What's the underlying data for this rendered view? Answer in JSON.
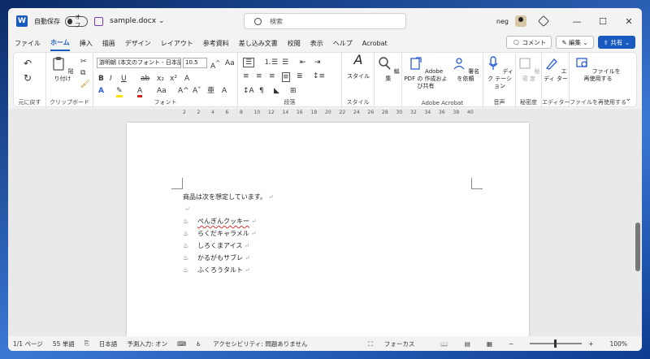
{
  "titlebar": {
    "autosave_label": "自動保存",
    "toggle_state": "オフ",
    "filename": "sample.docx",
    "search_placeholder": "検索",
    "user": "neg"
  },
  "tabs": [
    "ファイル",
    "ホーム",
    "挿入",
    "描画",
    "デザイン",
    "レイアウト",
    "参考資料",
    "差し込み文書",
    "校閲",
    "表示",
    "ヘルプ",
    "Acrobat"
  ],
  "menu_buttons": {
    "comment": "コメント",
    "edit": "編集",
    "share": "共有"
  },
  "ribbon": {
    "font_name": "游明朝 (本文のフォント - 日本語)",
    "font_size": "10.5",
    "groups": {
      "undo": "元に戻す",
      "clipboard": "クリップボード",
      "font": "フォント",
      "paragraph": "段落",
      "style": "スタイル",
      "acrobat": "Adobe Acrobat",
      "voice": "音声",
      "sensitivity": "秘密度",
      "editor": "エディター",
      "reuse": "ファイルを再使用する"
    },
    "buttons": {
      "paste": "貼り付け",
      "style": "スタイル",
      "edit": "編集",
      "adobe_pdf": "Adobe PDF の 作成および共有",
      "sign": "署名 を依頼",
      "dictate": "ディク テーション",
      "sensitivity": "秘密 度",
      "editor": "エディ ター",
      "reuse": "ファイルを 再使用する"
    }
  },
  "ruler_ticks": [
    "2",
    "2",
    "4",
    "6",
    "8",
    "10",
    "12",
    "14",
    "16",
    "18",
    "20",
    "22",
    "24",
    "26",
    "28",
    "30",
    "32",
    "34",
    "36",
    "38",
    "40"
  ],
  "document": {
    "intro": "商品は次を想定しています。",
    "items": [
      "ぺんぎんクッキー",
      "らくだキャラメル",
      "しろくまアイス",
      "かるがもサブレ",
      "ふくろうタルト"
    ]
  },
  "status": {
    "page": "1/1 ページ",
    "words": "55 単語",
    "language": "日本語",
    "predict": "予測入力: オン",
    "accessibility": "アクセシビリティ: 問題ありません",
    "focus": "フォーカス",
    "zoom": "100%"
  }
}
